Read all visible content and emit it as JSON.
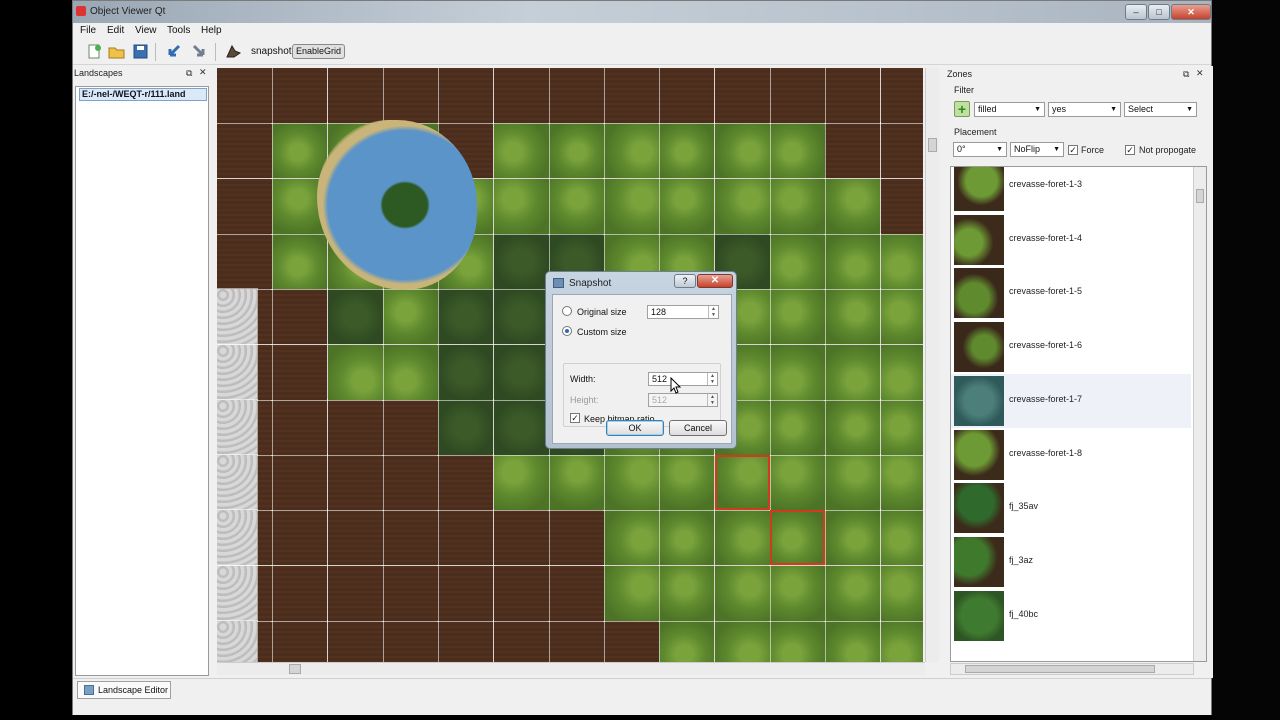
{
  "window": {
    "title": "Object Viewer Qt",
    "min_glyph": "–",
    "max_glyph": "□",
    "close_glyph": "✕"
  },
  "menu": [
    "File",
    "Edit",
    "View",
    "Tools",
    "Help"
  ],
  "toolbar": {
    "icons": [
      "new-icon",
      "open-icon",
      "save-icon",
      "undo-icon",
      "redo-icon",
      "snapshot-icon"
    ],
    "snapshot_label": "snapshot",
    "enable_grid_label": "EnableGrid"
  },
  "landscapes": {
    "title": "Landscapes",
    "items": [
      "E:/-nel-/WEQT-r/111.land"
    ]
  },
  "zones": {
    "title": "Zones",
    "filter_label": "Filter",
    "filter_values": [
      "filled",
      "yes",
      "Select"
    ],
    "placement_label": "Placement",
    "rotation": "0°",
    "flip": "NoFlip",
    "force_label": "Force",
    "force_checked": true,
    "not_propagate_label": "Not propogate",
    "not_propagate_checked": true,
    "selected_index": 4,
    "items": [
      "crevasse-foret-1-3",
      "crevasse-foret-1-4",
      "crevasse-foret-1-5",
      "crevasse-foret-1-6",
      "crevasse-foret-1-7",
      "crevasse-foret-1-8",
      "fj_35av",
      "fj_3az",
      "fj_40bc"
    ]
  },
  "dialog": {
    "title": "Snapshot",
    "help_glyph": "?",
    "close_glyph": "✕",
    "original_size_label": "Original size",
    "original_size_value": "128",
    "custom_size_label": "Custom size",
    "custom_size_selected": true,
    "width_label": "Width:",
    "width_value": "512",
    "height_label": "Height:",
    "height_value": "512",
    "keep_ratio_label": "Keep bitmap ratio",
    "keep_ratio_checked": true,
    "ok_label": "OK",
    "cancel_label": "Cancel"
  },
  "statusbar": {
    "tab_label": "Landscape Editor"
  },
  "colors": {
    "grass": "#5f8a2e",
    "forest": "#2f4a22",
    "dirt": "#4a2d1c",
    "water": "#5b94c8",
    "grid_line": "#ffffff",
    "zone_border": "#d23a1e"
  }
}
